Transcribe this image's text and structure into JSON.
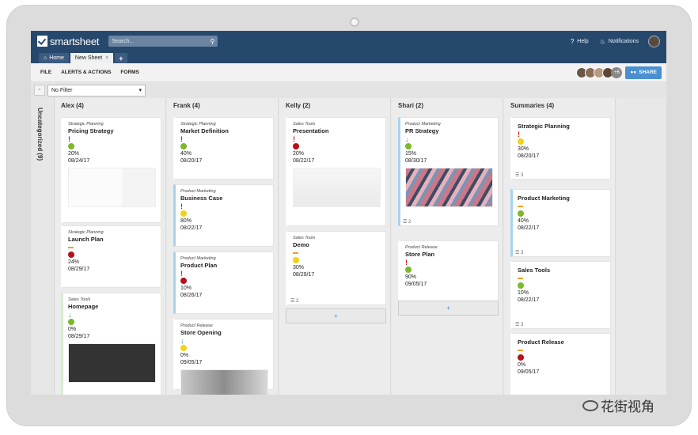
{
  "app": {
    "logo_text": "smartsheet"
  },
  "search": {
    "placeholder": "Search..."
  },
  "topbar": {
    "help": "Help",
    "notifications": "Notifications"
  },
  "tabs": [
    {
      "label": "Home"
    },
    {
      "label": "New Sheet"
    }
  ],
  "menu": [
    "FILE",
    "ALERTS & ACTIONS",
    "FORMS"
  ],
  "collaborators": {
    "more": "+6"
  },
  "share_label": "SHARE",
  "filter": {
    "value": "No Filter"
  },
  "uncategorized": "Uncategorized (9)",
  "lanes": [
    {
      "title": "Alex (4)",
      "cards": [
        {
          "category": "Strategic Planning",
          "title": "Pricing Strategy",
          "priority": "high",
          "status_color": "#7ab929",
          "percent": "20%",
          "date": "08/24/17",
          "image": "chart-thumbnail",
          "accent": "none"
        },
        {
          "category": "Strategic Planning",
          "title": "Launch Plan",
          "priority": "medium",
          "status_color": "#b8111a",
          "percent": "24%",
          "date": "08/29/17",
          "accent": "none"
        },
        {
          "category": "Sales Tools",
          "title": "Homepage",
          "priority": "low",
          "status_color": "#7ab929",
          "percent": "0%",
          "date": "08/29/17",
          "image": "website-thumbnail",
          "accent": "green"
        }
      ]
    },
    {
      "title": "Frank (4)",
      "cards": [
        {
          "category": "Strategic Planning",
          "title": "Market Definition",
          "priority": "high",
          "status_color": "#7ab929",
          "percent": "40%",
          "date": "08/20/17",
          "accent": "none"
        },
        {
          "category": "Product Marketing",
          "title": "Business Case",
          "priority": "high",
          "status_color": "#f1d21a",
          "percent": "80%",
          "date": "08/22/17",
          "accent": "blue"
        },
        {
          "category": "Product Marketing",
          "title": "Product Plan",
          "priority": "high",
          "status_color": "#b8111a",
          "percent": "10%",
          "date": "08/26/17",
          "accent": "blue"
        },
        {
          "category": "Product Release",
          "title": "Store Opening",
          "priority": "low",
          "status_color": "#f1d21a",
          "percent": "0%",
          "date": "09/05/17",
          "image": "store-thumbnail",
          "accent": "none"
        }
      ]
    },
    {
      "title": "Kelly (2)",
      "add": "+",
      "cards": [
        {
          "category": "Sales Tools",
          "title": "Presentation",
          "priority": "high",
          "status_color": "#b8111a",
          "percent": "20%",
          "date": "08/22/17",
          "image": "sketch-thumbnail",
          "accent": "none"
        },
        {
          "category": "Sales Tools",
          "title": "Demo",
          "priority": "medium",
          "status_color": "#f1d21a",
          "percent": "30%",
          "date": "08/29/17",
          "count": "2",
          "accent": "none"
        }
      ]
    },
    {
      "title": "Shari (2)",
      "add": "+",
      "cards": [
        {
          "category": "Product Marketing",
          "title": "PR Strategy",
          "priority": "low",
          "status_color": "#7ab929",
          "percent": "15%",
          "date": "08/30/17",
          "image": "magazine-thumbnail",
          "count": "2",
          "accent": "blue"
        },
        {
          "category": "Product Release",
          "title": "Store Plan",
          "priority": "high",
          "status_color": "#7ab929",
          "percent": "90%",
          "date": "09/05/17",
          "accent": "none"
        }
      ]
    },
    {
      "title": "Summaries (4)",
      "cards": [
        {
          "title": "Strategic Planning",
          "priority": "high",
          "status_color": "#f1d21a",
          "percent": "30%",
          "date": "08/20/17",
          "count": "3",
          "accent": "none"
        },
        {
          "title": "Product Marketing",
          "priority": "medium",
          "status_color": "#7ab929",
          "percent": "40%",
          "date": "08/22/17",
          "count": "3",
          "accent": "blue"
        },
        {
          "title": "Sales Tools",
          "priority": "medium",
          "status_color": "#7ab929",
          "percent": "10%",
          "date": "08/22/17",
          "count": "3",
          "accent": "none"
        },
        {
          "title": "Product Release",
          "priority": "medium",
          "status_color": "#b8111a",
          "percent": "0%",
          "date": "09/05/17",
          "accent": "none"
        }
      ]
    }
  ],
  "watermark": "花街视角"
}
